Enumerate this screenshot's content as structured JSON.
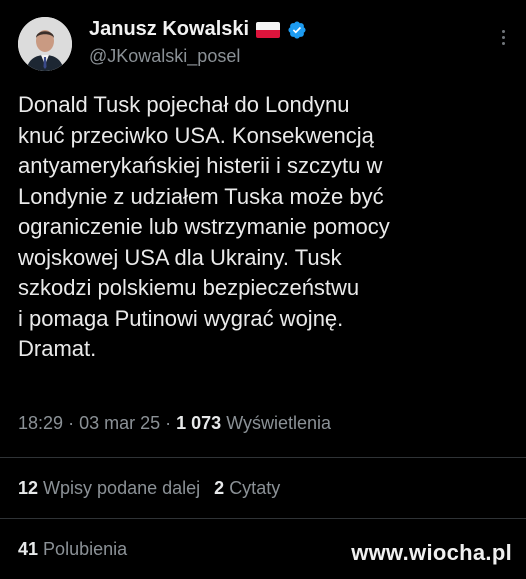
{
  "author": {
    "name": "Janusz Kowalski",
    "handle": "@JKowalski_posel"
  },
  "tweet": {
    "text": "Donald Tusk pojechał do Londynu\nknuć przeciwko USA. Konsekwencją\nantyamerykańskiej histerii i szczytu w\nLondynie z udziałem Tuska może być\nograniczenie lub wstrzymanie pomocy\nwojskowej USA dla Ukrainy. Tusk\nszkodzi polskiemu bezpieczeństwu\ni pomaga Putinowi wygrać wojnę.\nDramat.",
    "time": "18:29",
    "date": "03 mar 25",
    "views_count": "1 073",
    "views_label": "Wyświetlenia"
  },
  "stats": {
    "reposts_count": "12",
    "reposts_label": "Wpisy podane dalej",
    "quotes_count": "2",
    "quotes_label": "Cytaty",
    "likes_count": "41",
    "likes_label": "Polubienia"
  },
  "watermark": "www.wiocha.pl",
  "icons": {
    "verified": "verified-badge-icon",
    "flag": "poland-flag-icon",
    "more": "more-options-icon"
  },
  "colors": {
    "background": "#000000",
    "text": "#e7e9ea",
    "muted": "#71767b",
    "verified": "#1d9bf0",
    "flag_red": "#dc143c"
  }
}
